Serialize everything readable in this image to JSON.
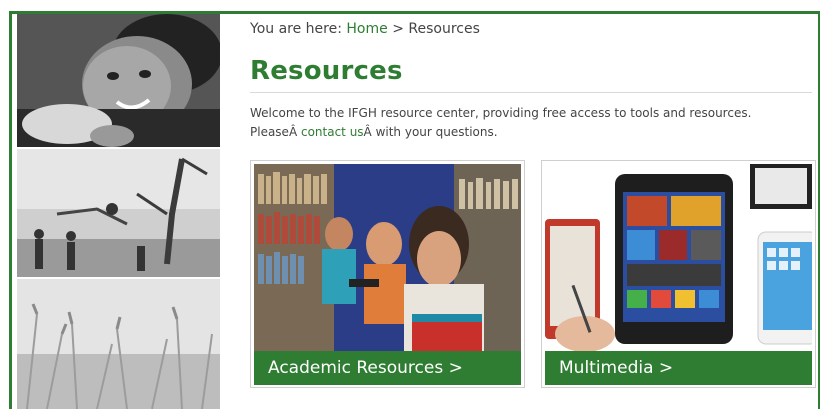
{
  "breadcrumb": {
    "prefix": "You are here:",
    "home_label": "Home",
    "separator": ">",
    "current": "Resources"
  },
  "page": {
    "title": "Resources",
    "intro_line1": "Welcome to the IFGH resource center, providing free access to tools and resources.",
    "intro_line2_prefix": "PleaseÂ ",
    "intro_contact_link": "contact us",
    "intro_line2_suffix": "Â with your questions."
  },
  "cards": [
    {
      "label": "Academic Resources >"
    },
    {
      "label": "Multimedia >"
    }
  ],
  "colors": {
    "accent": "#2f7d32",
    "card_bar": "#2e7d32"
  },
  "left_panel": {
    "images": [
      "child-photo",
      "swing-photo",
      "grass-photo"
    ]
  }
}
